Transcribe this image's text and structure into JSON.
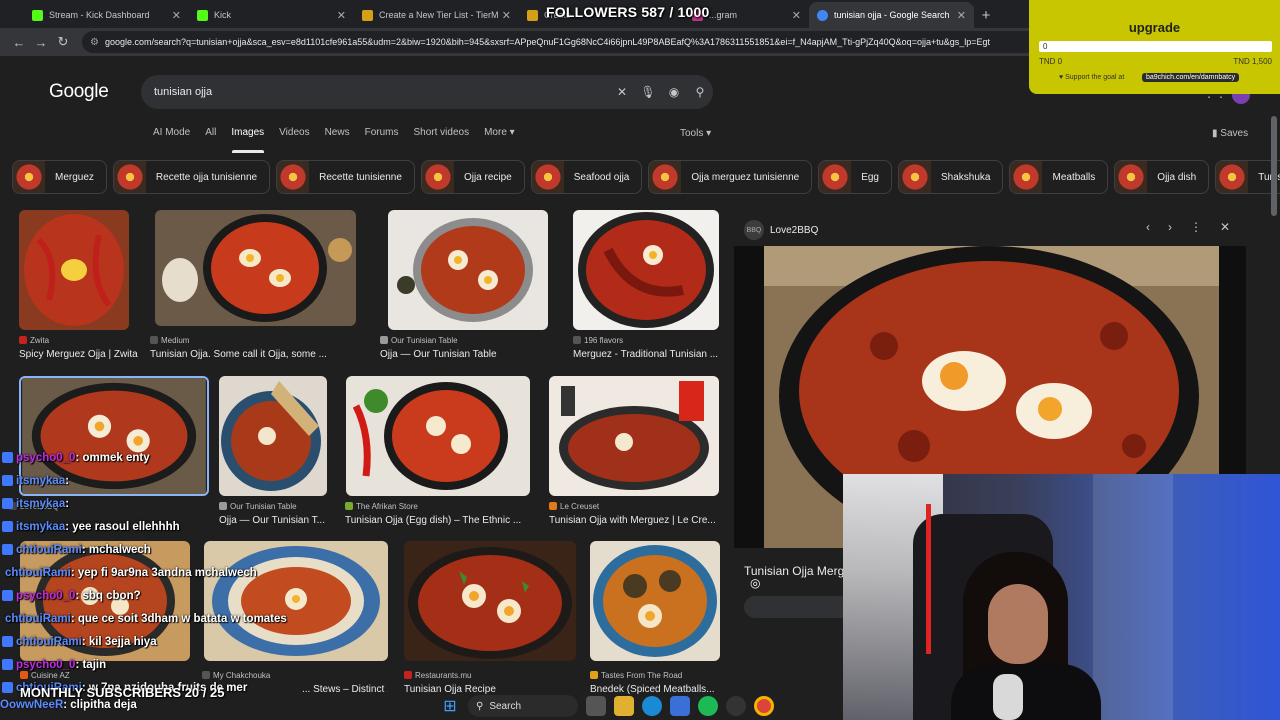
{
  "browser": {
    "tabs": [
      {
        "label": "Stream - Kick Dashboard",
        "color": "#53fc18"
      },
      {
        "label": "Kick",
        "color": "#53fc18"
      },
      {
        "label": "Create a New Tier List - TierMaker",
        "color": "#d4a017"
      },
      {
        "label": "Create",
        "color": "#d4a017"
      },
      {
        "label": "...gram",
        "color": "#c13584"
      },
      {
        "label": "tunisian ojja - Google Search",
        "color": "#4285f4"
      }
    ],
    "url": "google.com/search?q=tunisian+ojja&sca_esv=e8d1101cfe961a55&udm=2&biw=1920&bih=945&sxsrf=APpeQnuF1Gg68NcC4i66jpnL49P8ABEafQ%3A1786311551851&ei=f_N4apjAM_Tti-gPjZq40Q&oq=ojja+tu&gs_lp=Egt"
  },
  "google": {
    "logo": "Google",
    "query": "tunisian ojja",
    "nav": [
      "AI Mode",
      "All",
      "Images",
      "Videos",
      "News",
      "Forums",
      "Short videos",
      "More ▾"
    ],
    "tools": "Tools ▾",
    "saves": "Saves",
    "chips": [
      "Merguez",
      "Recette ojja tunisienne",
      "Recette tunisienne",
      "Ojja recipe",
      "Seafood ojja",
      "Ojja merguez tunisienne",
      "Egg",
      "Shakshuka",
      "Meatballs",
      "Ojja dish",
      "Tunisian cuisin"
    ],
    "results": [
      {
        "source": "Zwita",
        "title": "Spicy Merguez Ojja | Zwita"
      },
      {
        "source": "Medium",
        "title": "Tunisian Ojja. Some call it Ojja, some ..."
      },
      {
        "source": "Our Tunisian Table",
        "title": "Ojja — Our Tunisian Table"
      },
      {
        "source": "196 flavors",
        "title": "Merguez - Traditional Tunisian ..."
      },
      {
        "source": "Love2BBQ",
        "title": ""
      },
      {
        "source": "Our Tunisian Table",
        "title": "Ojja — Our Tunisian T..."
      },
      {
        "source": "The Afrikan Store",
        "title": "Tunisian Ojja (Egg dish) – The Ethnic ..."
      },
      {
        "source": "Le Creuset",
        "title": "Tunisian Ojja with Merguez | Le Cre..."
      },
      {
        "source": "Cuisine AZ",
        "title": ""
      },
      {
        "source": "My Chakchouka",
        "title": "... Stews – Distinct ..."
      },
      {
        "source": "Restaurants.mu",
        "title": "Tunisian Ojja Recipe"
      },
      {
        "source": "Tastes From The Road",
        "title": "Bnedek (Spiced Meatballs..."
      }
    ],
    "panel": {
      "source": "Love2BBQ",
      "title": "Tunisian Ojja Merg"
    }
  },
  "overlay": {
    "followers": "FOLLOWERS 587 / 1000",
    "goal": {
      "title": "upgrade",
      "current": "0",
      "min": "TND 0",
      "max": "TND 1,500",
      "support": "Support the goal at",
      "link": "ba9chich.com/en/damnbatcy",
      "progress": 0
    },
    "monthly": "MONTHLY SUBSCRIBERS 20 / 25",
    "chat": [
      {
        "user": "psycho0_0",
        "msg": ": ommek enty",
        "p": true
      },
      {
        "user": "itsmykaa",
        "msg": ":",
        "p": false
      },
      {
        "user": "itsmykaa",
        "msg": ":",
        "p": false
      },
      {
        "user": "itsmykaa",
        "msg": ": yee rasoul ellehhhh",
        "p": false
      },
      {
        "user": "chtiouiRami",
        "msg": ": mchalwech",
        "p": false
      },
      {
        "user": "chtiouiRami",
        "msg": ": yep fi 9ar9na 3andna mchalwech",
        "p": false
      },
      {
        "user": "psycho0_0",
        "msg": ": sbq cbon?",
        "p": true
      },
      {
        "user": "chtiouiRami",
        "msg": ": que ce soit 3dham w batata w tomates",
        "p": false
      },
      {
        "user": "chtiouiRami",
        "msg": ": kil 3ejja hiya",
        "p": false
      },
      {
        "user": "psycho0_0",
        "msg": ": tajin",
        "p": true
      },
      {
        "user": "chtiouiRami",
        "msg": ": w 7na nzidouha fruits de mer",
        "p": false
      }
    ],
    "last": {
      "user": "OowwNeeR",
      "msg": ": clipitha deja"
    }
  },
  "taskbar": {
    "search": "Search"
  }
}
